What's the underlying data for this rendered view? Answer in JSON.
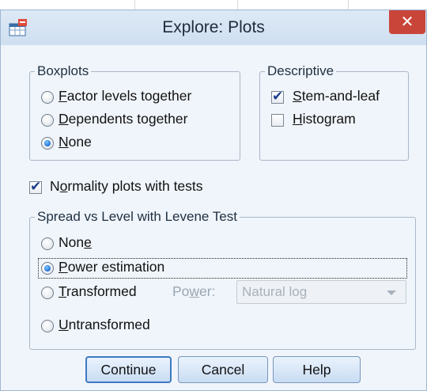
{
  "window": {
    "title": "Explore: Plots",
    "close_label": "✕"
  },
  "icons": {
    "app": "spss-data-editor-icon",
    "close": "close-icon"
  },
  "boxplots": {
    "legend": "Boxplots",
    "options": [
      {
        "pre": "",
        "u": "F",
        "post": "actor levels together",
        "checked": false
      },
      {
        "pre": "",
        "u": "D",
        "post": "ependents together",
        "checked": false
      },
      {
        "pre": "",
        "u": "N",
        "post": "one",
        "checked": true
      }
    ]
  },
  "descriptive": {
    "legend": "Descriptive",
    "stem_leaf": {
      "pre": "",
      "u": "S",
      "post": "tem-and-leaf",
      "checked": true
    },
    "histogram": {
      "pre": "",
      "u": "H",
      "post": "istogram",
      "checked": false
    }
  },
  "normality": {
    "pre": "N",
    "u": "o",
    "post": "rmality plots with tests",
    "checked": true
  },
  "spread": {
    "legend": "Spread vs Level with Levene Test",
    "none": {
      "pre": "Non",
      "u": "e",
      "post": "",
      "checked": false
    },
    "power_estimation": {
      "pre": "",
      "u": "P",
      "post": "ower estimation",
      "checked": true
    },
    "transformed": {
      "pre": "",
      "u": "T",
      "post": "ransformed",
      "checked": false
    },
    "power_label": {
      "pre": "Po",
      "u": "w",
      "post": "er:"
    },
    "power_select": "Natural log",
    "untransformed": {
      "pre": "",
      "u": "U",
      "post": "ntransformed",
      "checked": false
    }
  },
  "buttons": {
    "continue": "Continue",
    "cancel": "Cancel",
    "help": "Help"
  },
  "colors": {
    "close": "#c9453a",
    "radio_selected": "#1d6fd1",
    "checkmark": "#1d3f8f"
  }
}
